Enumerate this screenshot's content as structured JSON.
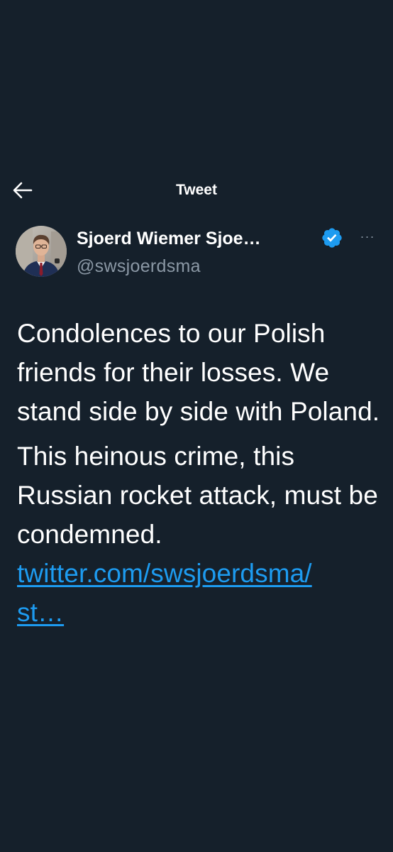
{
  "header": {
    "back_icon": "arrow-left-icon",
    "title": "Tweet"
  },
  "author": {
    "display_name": "Sjoerd Wiemer Sjoe…",
    "handle": "@swsjoerdsma",
    "verified_icon": "verified-badge-icon",
    "more_icon": "more-options-icon",
    "more_glyph": "···"
  },
  "tweet": {
    "paragraph1": "Condolences to our Polish friends for their losses. We stand side by side with Poland.",
    "paragraph2": "This heinous crime, this Russian rocket attack, must be condemned.",
    "link_line1": "twitter.com/swsjoerdsma/",
    "link_line2": "st…"
  },
  "colors": {
    "background": "#15202b",
    "text_primary": "#ffffff",
    "text_secondary": "#8b98a5",
    "accent": "#1d9bf0"
  }
}
